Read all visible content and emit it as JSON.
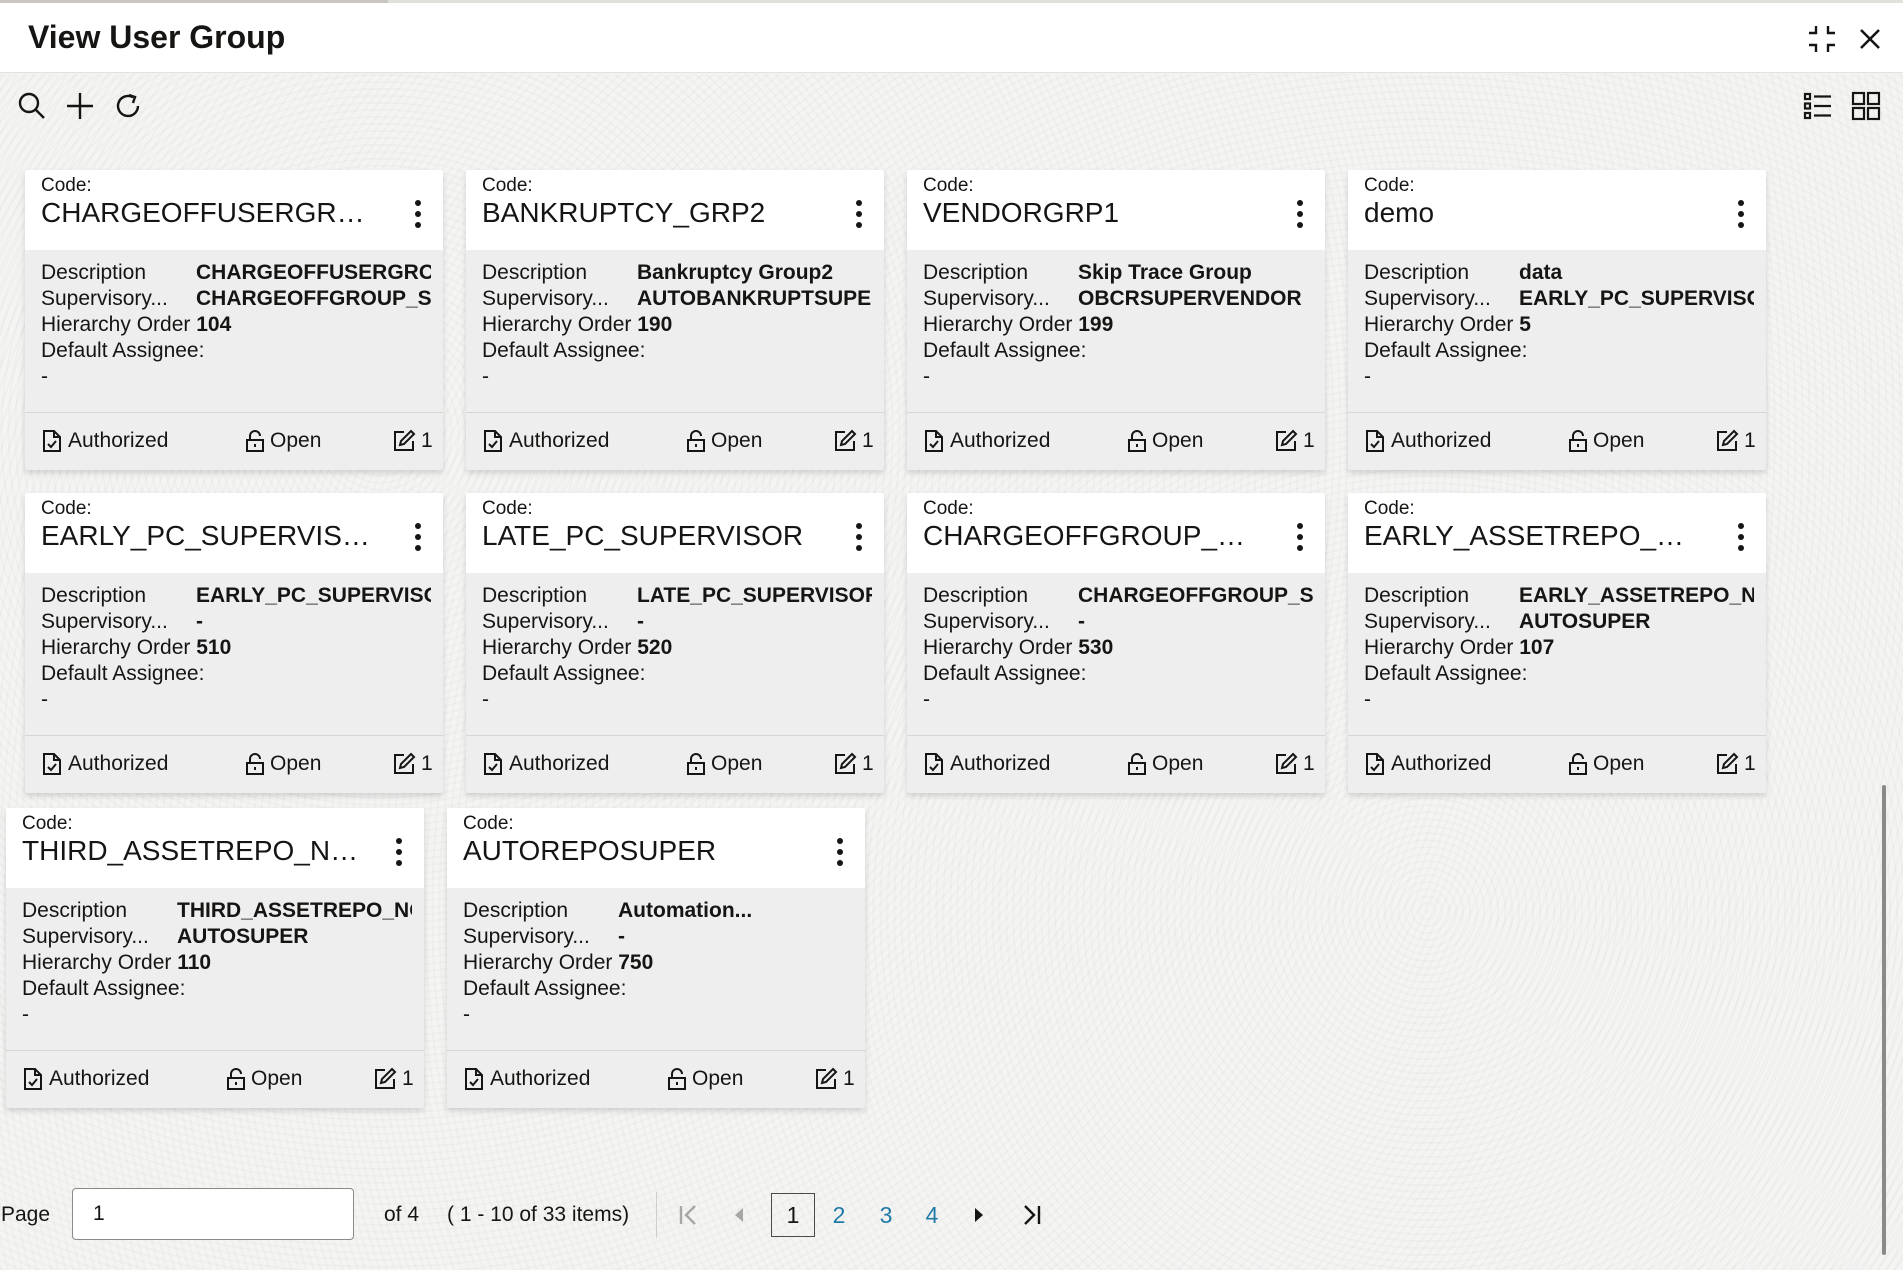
{
  "header": {
    "title": "View User Group"
  },
  "icons": {
    "search": "search-icon",
    "add": "plus-icon",
    "refresh": "refresh-icon",
    "list_view": "list-view-icon",
    "tile_view": "tile-view-icon",
    "minimize": "minimize-icon",
    "close": "close-icon"
  },
  "labels": {
    "code": "Code:",
    "description": "Description",
    "supervisory": "Supervisory...",
    "hierarchy_order": "Hierarchy Order",
    "default_assignee": "Default Assignee:",
    "authorized": "Authorized",
    "open": "Open"
  },
  "cards": [
    {
      "code": "CHARGEOFFUSERGROUP",
      "description": "CHARGEOFFUSERGROU",
      "supervisory": "CHARGEOFFGROUP_SU",
      "hierarchy_order": "104",
      "default_assignee": "-",
      "auth_status": "Authorized",
      "record_status": "Open",
      "modifications": "1"
    },
    {
      "code": "BANKRUPTCY_GRP2",
      "description": "Bankruptcy Group2",
      "supervisory": "AUTOBANKRUPTSUPER",
      "hierarchy_order": "190",
      "default_assignee": "-",
      "auth_status": "Authorized",
      "record_status": "Open",
      "modifications": "1"
    },
    {
      "code": "VENDORGRP1",
      "description": "Skip Trace Group",
      "supervisory": "OBCRSUPERVENDOR",
      "hierarchy_order": "199",
      "default_assignee": "-",
      "auth_status": "Authorized",
      "record_status": "Open",
      "modifications": "1"
    },
    {
      "code": "demo",
      "description": "data",
      "supervisory": "EARLY_PC_SUPERVISOF",
      "hierarchy_order": "5",
      "default_assignee": "-",
      "auth_status": "Authorized",
      "record_status": "Open",
      "modifications": "1"
    },
    {
      "code": "EARLY_PC_SUPERVISOR",
      "description": "EARLY_PC_SUPERVISOF",
      "supervisory": "-",
      "hierarchy_order": "510",
      "default_assignee": "-",
      "auth_status": "Authorized",
      "record_status": "Open",
      "modifications": "1"
    },
    {
      "code": "LATE_PC_SUPERVISOR",
      "description": "LATE_PC_SUPERVISOR",
      "supervisory": "-",
      "hierarchy_order": "520",
      "default_assignee": "-",
      "auth_status": "Authorized",
      "record_status": "Open",
      "modifications": "1"
    },
    {
      "code": "CHARGEOFFGROUP_SUP...",
      "description": "CHARGEOFFGROUP_SU",
      "supervisory": "-",
      "hierarchy_order": "530",
      "default_assignee": "-",
      "auth_status": "Authorized",
      "record_status": "Open",
      "modifications": "1"
    },
    {
      "code": "EARLY_ASSETREPO_NO_...",
      "description": "EARLY_ASSETREPO_NO",
      "supervisory": "AUTOSUPER",
      "hierarchy_order": "107",
      "default_assignee": "-",
      "auth_status": "Authorized",
      "record_status": "Open",
      "modifications": "1"
    },
    {
      "code": "THIRD_ASSETREPO_NO_...",
      "description": "THIRD_ASSETREPO_NO",
      "supervisory": "AUTOSUPER",
      "hierarchy_order": "110",
      "default_assignee": "-",
      "auth_status": "Authorized",
      "record_status": "Open",
      "modifications": "1"
    },
    {
      "code": "AUTOREPOSUPER",
      "description": "Automation...",
      "supervisory": "-",
      "hierarchy_order": "750",
      "default_assignee": "-",
      "auth_status": "Authorized",
      "record_status": "Open",
      "modifications": "1"
    }
  ],
  "pagination": {
    "page_label": "Page",
    "current_page": "1",
    "of_text": "of 4",
    "items_text": "( 1 - 10 of 33 items)",
    "pages": [
      "1",
      "2",
      "3",
      "4"
    ]
  }
}
